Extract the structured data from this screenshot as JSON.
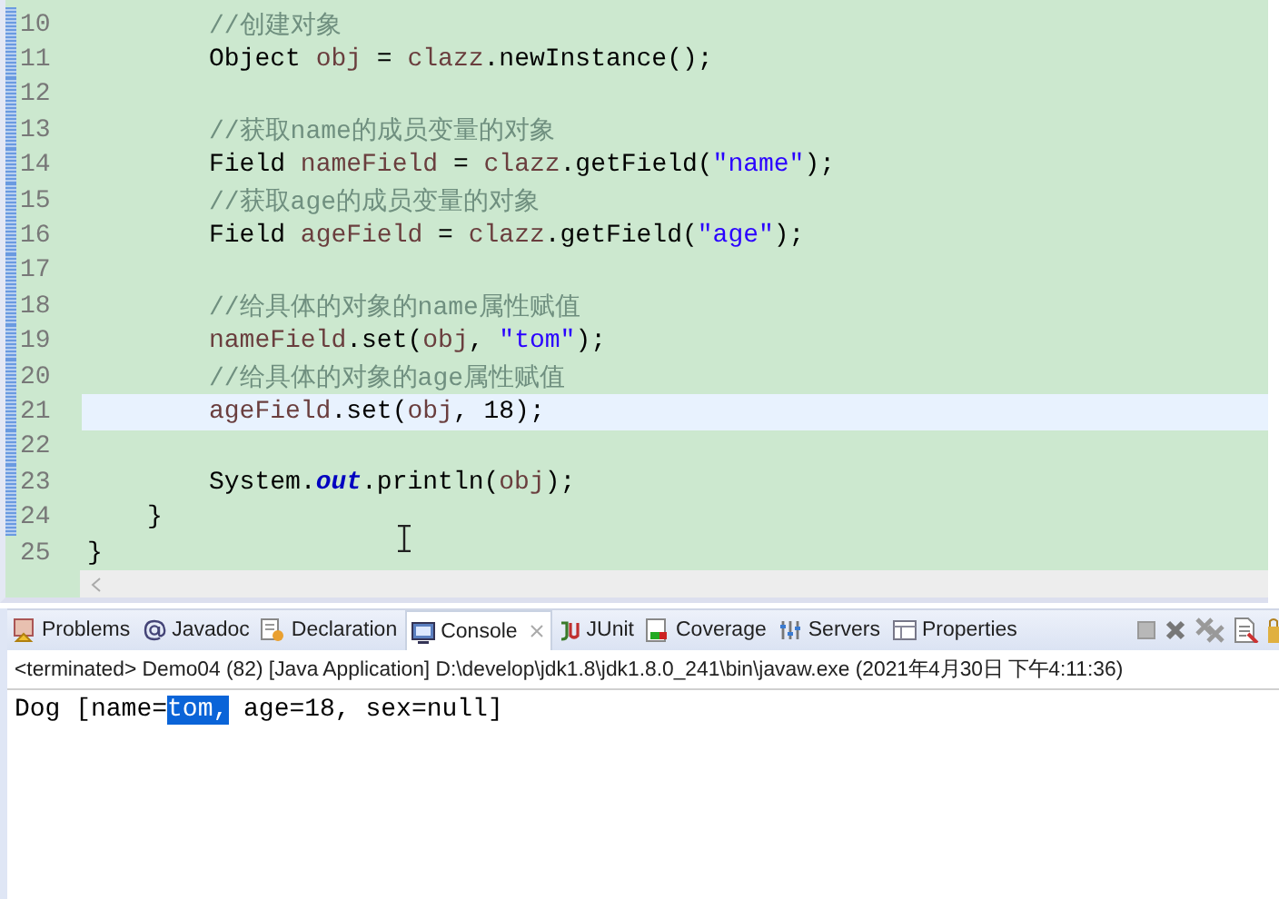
{
  "editor": {
    "lines": [
      {
        "number": "10",
        "kind": "body",
        "marked": true,
        "current": false,
        "segments": [
          {
            "kind": "comment",
            "text": "//创建对象"
          }
        ]
      },
      {
        "number": "11",
        "kind": "body",
        "marked": true,
        "current": false,
        "segments": [
          {
            "kind": "plain",
            "text": "Object "
          },
          {
            "kind": "variable",
            "text": "obj"
          },
          {
            "kind": "plain",
            "text": " = "
          },
          {
            "kind": "variable",
            "text": "clazz"
          },
          {
            "kind": "plain",
            "text": ".newInstance();"
          }
        ]
      },
      {
        "number": "12",
        "kind": "body",
        "marked": true,
        "current": false
      },
      {
        "number": "13",
        "kind": "body",
        "marked": true,
        "current": false,
        "segments": [
          {
            "kind": "comment",
            "text": "//获取name的成员变量的对象"
          }
        ]
      },
      {
        "number": "14",
        "kind": "body",
        "marked": true,
        "current": false,
        "segments": [
          {
            "kind": "plain",
            "text": "Field "
          },
          {
            "kind": "variable",
            "text": "nameField"
          },
          {
            "kind": "plain",
            "text": " = "
          },
          {
            "kind": "variable",
            "text": "clazz"
          },
          {
            "kind": "plain",
            "text": ".getField("
          },
          {
            "kind": "string",
            "text": "\"name\""
          },
          {
            "kind": "plain",
            "text": ");"
          }
        ]
      },
      {
        "number": "15",
        "kind": "body",
        "marked": true,
        "current": false,
        "segments": [
          {
            "kind": "comment",
            "text": "//获取age的成员变量的对象"
          }
        ]
      },
      {
        "number": "16",
        "kind": "body",
        "marked": true,
        "current": false,
        "segments": [
          {
            "kind": "plain",
            "text": "Field "
          },
          {
            "kind": "variable",
            "text": "ageField"
          },
          {
            "kind": "plain",
            "text": " = "
          },
          {
            "kind": "variable",
            "text": "clazz"
          },
          {
            "kind": "plain",
            "text": ".getField("
          },
          {
            "kind": "string",
            "text": "\"age\""
          },
          {
            "kind": "plain",
            "text": ");"
          }
        ]
      },
      {
        "number": "17",
        "kind": "body",
        "marked": true,
        "current": false
      },
      {
        "number": "18",
        "kind": "body",
        "marked": true,
        "current": false,
        "segments": [
          {
            "kind": "comment",
            "text": "//给具体的对象的name属性赋值"
          }
        ]
      },
      {
        "number": "19",
        "kind": "body",
        "marked": true,
        "current": false,
        "segments": [
          {
            "kind": "variable",
            "text": "nameField"
          },
          {
            "kind": "plain",
            "text": ".set("
          },
          {
            "kind": "variable",
            "text": "obj"
          },
          {
            "kind": "plain",
            "text": ", "
          },
          {
            "kind": "string",
            "text": "\"tom\""
          },
          {
            "kind": "plain",
            "text": ");"
          }
        ]
      },
      {
        "number": "20",
        "kind": "body",
        "marked": true,
        "current": false,
        "segments": [
          {
            "kind": "comment",
            "text": "//给具体的对象的age属性赋值"
          }
        ]
      },
      {
        "number": "21",
        "kind": "body",
        "marked": true,
        "current": true,
        "segments": [
          {
            "kind": "variable",
            "text": "ageField"
          },
          {
            "kind": "plain",
            "text": ".set("
          },
          {
            "kind": "variable",
            "text": "obj"
          },
          {
            "kind": "plain",
            "text": ", 18);"
          }
        ]
      },
      {
        "number": "22",
        "kind": "body",
        "marked": true,
        "current": false
      },
      {
        "number": "23",
        "kind": "body",
        "marked": true,
        "current": false,
        "segments": [
          {
            "kind": "plain",
            "text": "System."
          },
          {
            "kind": "static",
            "text": "out"
          },
          {
            "kind": "plain",
            "text": ".println("
          },
          {
            "kind": "variable",
            "text": "obj"
          },
          {
            "kind": "plain",
            "text": ");"
          }
        ]
      },
      {
        "number": "24",
        "kind": "method_end",
        "marked": true,
        "current": false,
        "segments": [
          {
            "kind": "plain",
            "text": "}"
          }
        ]
      },
      {
        "number": "25",
        "kind": "class_end",
        "marked": false,
        "current": false,
        "segments": [
          {
            "kind": "plain",
            "text": "}"
          }
        ]
      }
    ]
  },
  "console": {
    "tabs": [
      {
        "label": "Problems",
        "selected": false
      },
      {
        "label": "Javadoc",
        "selected": false
      },
      {
        "label": "Declaration",
        "selected": false
      },
      {
        "label": "Console",
        "selected": true
      },
      {
        "label": "JUnit",
        "selected": false
      },
      {
        "label": "Coverage",
        "selected": false
      },
      {
        "label": "Servers",
        "selected": false
      },
      {
        "label": "Properties",
        "selected": false
      }
    ],
    "status": "<terminated> Demo04 (82) [Java Application] D:\\develop\\jdk1.8\\jdk1.8.0_241\\bin\\javaw.exe (2021年4月30日 下午4:11:36)",
    "output": [
      {
        "text": "Dog [name=",
        "selected": false
      },
      {
        "text": "tom,",
        "selected": true
      },
      {
        "text": " age=18, sex=null]",
        "selected": false
      }
    ]
  }
}
